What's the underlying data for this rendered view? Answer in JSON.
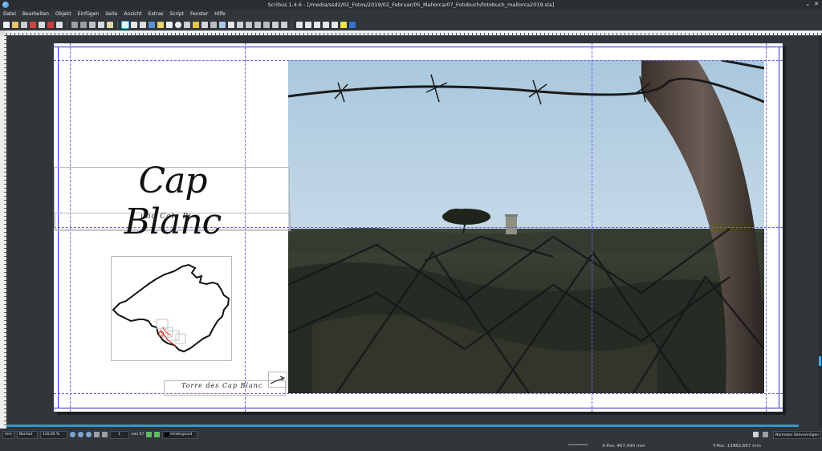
{
  "window": {
    "title": "Scribus 1.4.6 - [/media/ssd2/02_Fotos/2019/02_Februar/05_Mallorca/07_Fotobuch/fotobuch_mallorca2019.sla]",
    "controls": [
      "⌄",
      "✕"
    ]
  },
  "menu": {
    "items": [
      "Datei",
      "Bearbeiten",
      "Objekt",
      "Einfügen",
      "Seite",
      "Ansicht",
      "Extras",
      "Script",
      "Fenster",
      "Hilfe"
    ]
  },
  "document": {
    "title": "Cap Blanc",
    "subtitle": "und Cala Pi",
    "caption": "Torre des Cap Blanc"
  },
  "status": {
    "unit": "mm",
    "mode": "Normal",
    "zoom": "110,00 %",
    "page_current": "1",
    "page_total_label": "von 57",
    "layer": "Hintergrund",
    "x_pos": "X-Pos:  467,430 mm",
    "y_pos": "Y-Pos:  13982,667 mm",
    "preview_mode": "Normales Sehvermögen"
  },
  "colors": {
    "accent": "#3daee9",
    "guide": "#6a62d8",
    "margin": "#2b2bd6",
    "map_route": "#e0322c"
  }
}
